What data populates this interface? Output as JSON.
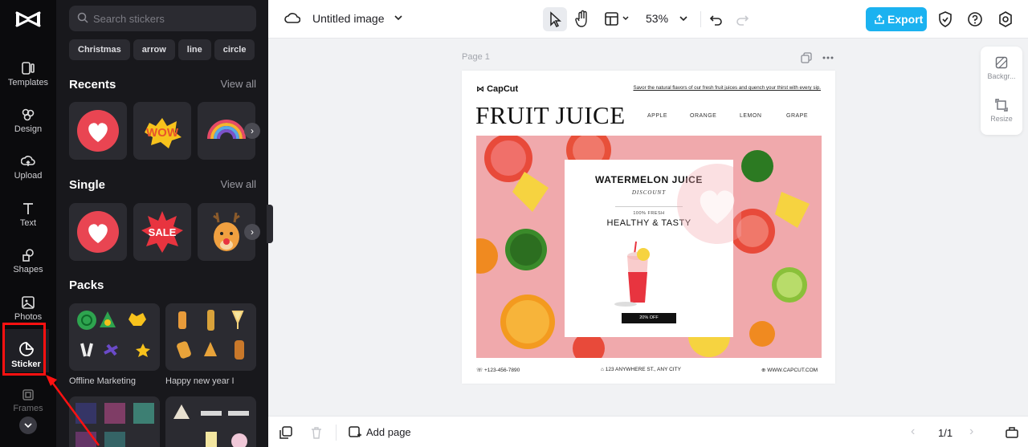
{
  "sidebar": {
    "items": [
      {
        "label": "Templates"
      },
      {
        "label": "Design"
      },
      {
        "label": "Upload"
      },
      {
        "label": "Text"
      },
      {
        "label": "Shapes"
      },
      {
        "label": "Photos"
      },
      {
        "label": "Sticker"
      },
      {
        "label": "Frames"
      }
    ],
    "active": "Sticker"
  },
  "panel": {
    "search_placeholder": "Search stickers",
    "chips": [
      "Christmas",
      "arrow",
      "line",
      "circle"
    ],
    "recents": {
      "title": "Recents",
      "view_all": "View all"
    },
    "single": {
      "title": "Single",
      "view_all": "View all"
    },
    "packs": {
      "title": "Packs",
      "items": [
        {
          "label": "Offline Marketing"
        },
        {
          "label": "Happy new year I"
        }
      ]
    },
    "sticker_text": {
      "wow": "WOW",
      "sale": "SALE"
    }
  },
  "topbar": {
    "title": "Untitled image",
    "zoom": "53%",
    "export_label": "Export"
  },
  "canvas": {
    "page_label": "Page 1",
    "brand": "CapCut",
    "tagline": "Savor the natural flavors of our fresh fruit juices and quench your thirst with every sip.",
    "headline": "FRUIT JUICE",
    "nav": [
      "APPLE",
      "ORANGE",
      "LEMON",
      "GRAPE"
    ],
    "card": {
      "title": "WATERMELON JUICE",
      "subtitle": "DISCOUNT",
      "small": "100% FRESH",
      "big": "HEALTHY & TASTY",
      "offer": "20% OFF"
    },
    "footer": {
      "phone": "+123-456-7890",
      "address": "123 ANYWHERE ST., ANY CITY",
      "website": "WWW.CAPCUT.COM"
    }
  },
  "side_tools": [
    {
      "label": "Backgr..."
    },
    {
      "label": "Resize"
    }
  ],
  "bottombar": {
    "add_page": "Add page",
    "pager": "1/1"
  },
  "colors": {
    "accent": "#1bb2f0",
    "rail_bg": "#0b0b0d",
    "panel_bg": "#18181c",
    "highlight": "#ff1111"
  }
}
